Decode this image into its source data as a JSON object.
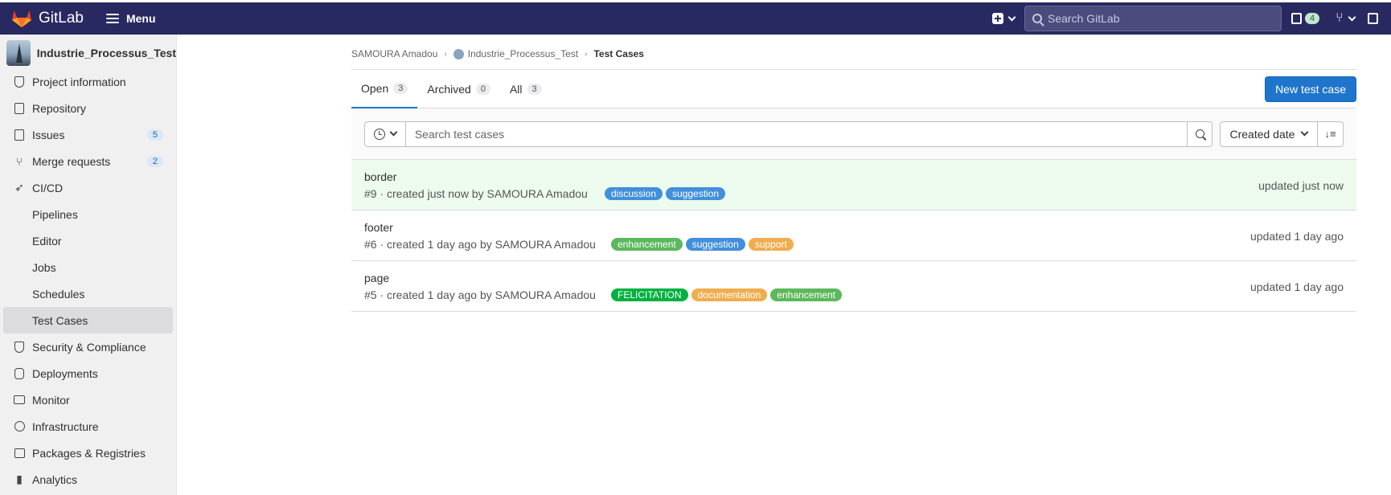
{
  "topbar": {
    "brand": "GitLab",
    "menu_label": "Menu",
    "search_placeholder": "Search GitLab",
    "todo_count": "4"
  },
  "sidebar": {
    "project_name": "Industrie_Processus_Test",
    "items": [
      {
        "label": "Project information",
        "icon": "project-info-icon"
      },
      {
        "label": "Repository",
        "icon": "repository-icon"
      },
      {
        "label": "Issues",
        "icon": "issues-icon",
        "count": "5"
      },
      {
        "label": "Merge requests",
        "icon": "merge-request-icon",
        "count": "2"
      },
      {
        "label": "CI/CD",
        "icon": "rocket-icon"
      },
      {
        "label": "Pipelines",
        "sub": true
      },
      {
        "label": "Editor",
        "sub": true
      },
      {
        "label": "Jobs",
        "sub": true
      },
      {
        "label": "Schedules",
        "sub": true
      },
      {
        "label": "Test Cases",
        "sub": true,
        "active": true
      },
      {
        "label": "Security & Compliance",
        "icon": "shield-icon"
      },
      {
        "label": "Deployments",
        "icon": "deployments-icon"
      },
      {
        "label": "Monitor",
        "icon": "monitor-icon"
      },
      {
        "label": "Infrastructure",
        "icon": "cloud-icon"
      },
      {
        "label": "Packages & Registries",
        "icon": "package-icon"
      },
      {
        "label": "Analytics",
        "icon": "chart-icon"
      }
    ]
  },
  "breadcrumb": {
    "owner": "SAMOURA Amadou",
    "project": "Industrie_Processus_Test",
    "current": "Test Cases"
  },
  "tabs": [
    {
      "label": "Open",
      "count": "3"
    },
    {
      "label": "Archived",
      "count": "0"
    },
    {
      "label": "All",
      "count": "3"
    }
  ],
  "new_button": "New test case",
  "filter": {
    "placeholder": "Search test cases",
    "sort_label": "Created date"
  },
  "test_cases": [
    {
      "title": "border",
      "meta": "#9 · created just now by SAMOURA Amadou",
      "labels": [
        {
          "text": "discussion",
          "color": "#428fdc"
        },
        {
          "text": "suggestion",
          "color": "#428fdc"
        }
      ],
      "updated": "updated just now",
      "highlight": true
    },
    {
      "title": "footer",
      "meta": "#6 · created 1 day ago by SAMOURA Amadou",
      "labels": [
        {
          "text": "enhancement",
          "color": "#5cb85c"
        },
        {
          "text": "suggestion",
          "color": "#428fdc"
        },
        {
          "text": "support",
          "color": "#f0ad4e"
        }
      ],
      "updated": "updated 1 day ago",
      "highlight": false
    },
    {
      "title": "page",
      "meta": "#5 · created 1 day ago by SAMOURA Amadou",
      "labels": [
        {
          "text": "FELICITATION",
          "color": "#00b140"
        },
        {
          "text": "documentation",
          "color": "#f0ad4e"
        },
        {
          "text": "enhancement",
          "color": "#5cb85c"
        }
      ],
      "updated": "updated 1 day ago",
      "highlight": false
    }
  ],
  "colors": {
    "navbar": "#292961",
    "primary": "#1f75cb",
    "highlight_row": "#ecfbee"
  }
}
